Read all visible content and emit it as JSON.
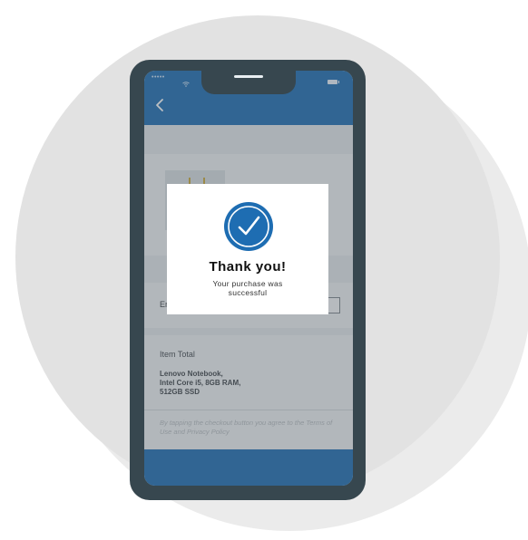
{
  "status_bar": {
    "signal_dots": "•••••",
    "icons": [
      "wifi-icon",
      "battery-icon"
    ]
  },
  "header": {
    "back_icon": "chevron-left-icon"
  },
  "checkout": {
    "email_label": "Er",
    "item_total_label": "Item Total",
    "item_description": "Lenovo Notebook,\nIntel Core i5, 8GB RAM,\n512GB SSD",
    "terms_text": "By tapping the checkout button you agree to the Terms of Use and Privacy Policy"
  },
  "modal": {
    "icon": "checkmark-circle-icon",
    "title": "Thank you!",
    "message": "Your purchase was successful"
  },
  "colors": {
    "accent": "#1e6db2",
    "phone_frame": "#37474f",
    "background_circle": "#e2e2e2"
  }
}
